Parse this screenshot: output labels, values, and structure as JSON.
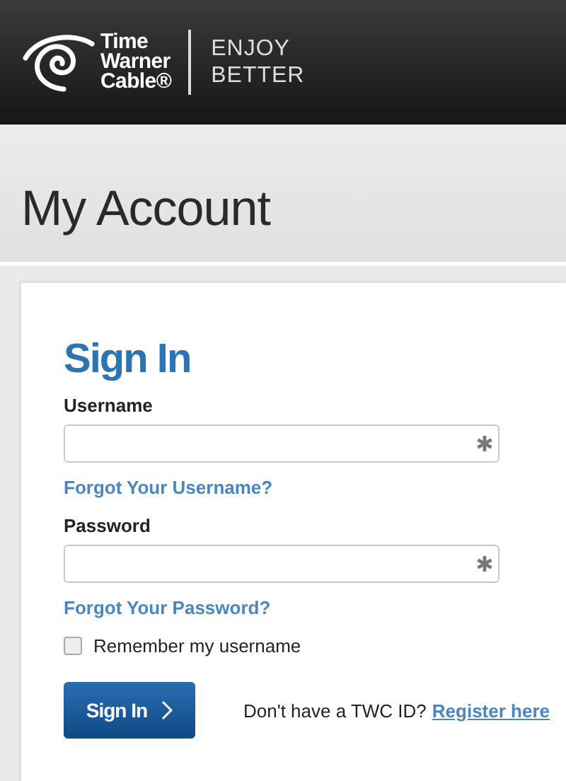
{
  "header": {
    "brand_lines": [
      "Time",
      "Warner",
      "Cable®"
    ],
    "tagline_lines": [
      "ENJOY",
      "BETTER"
    ]
  },
  "page_title": "My Account",
  "sign_in": {
    "title": "Sign In",
    "fields": [
      {
        "label": "Username",
        "required": true,
        "link": "Forgot Your Username?"
      },
      {
        "label": "Password",
        "required": true,
        "link": "Forgot Your Password?"
      }
    ],
    "remember": {
      "label": "Remember my username",
      "checked": false
    },
    "button": "Sign In",
    "register_prompt": "Don't have a TWC ID?",
    "register_link": "Register here"
  }
}
